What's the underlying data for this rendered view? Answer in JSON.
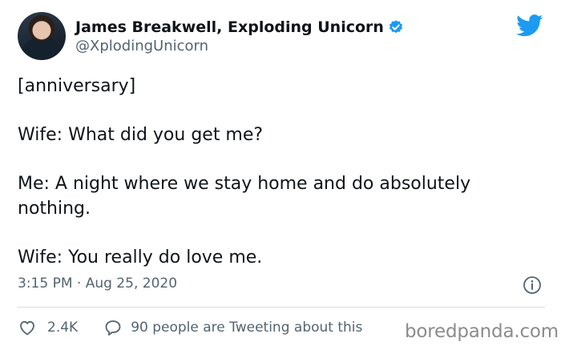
{
  "author": {
    "display_name": "James Breakwell, Exploding Unicorn",
    "handle": "@XplodingUnicorn",
    "verified_icon": "verified-badge-icon",
    "avatar_icon": "profile-photo"
  },
  "brand": {
    "icon": "twitter-bird-icon",
    "color": "#1d9bf0"
  },
  "tweet": {
    "text": "[anniversary]\n\nWife: What did you get me?\n\nMe: A night where we stay home and do absolutely nothing.\n\nWife: You really do love me.",
    "timestamp": "3:15 PM · Aug 25, 2020"
  },
  "actions": {
    "like_icon": "heart-icon",
    "like_count": "2.4K",
    "reply_icon": "speech-bubble-icon",
    "reply_label": "90 people are Tweeting about this"
  },
  "info_icon": "info-icon",
  "watermark": "boredpanda.com",
  "colors": {
    "text": "#0f1419",
    "secondary": "#536471",
    "verified": "#1d9bf0",
    "divider": "#d7dce0"
  }
}
